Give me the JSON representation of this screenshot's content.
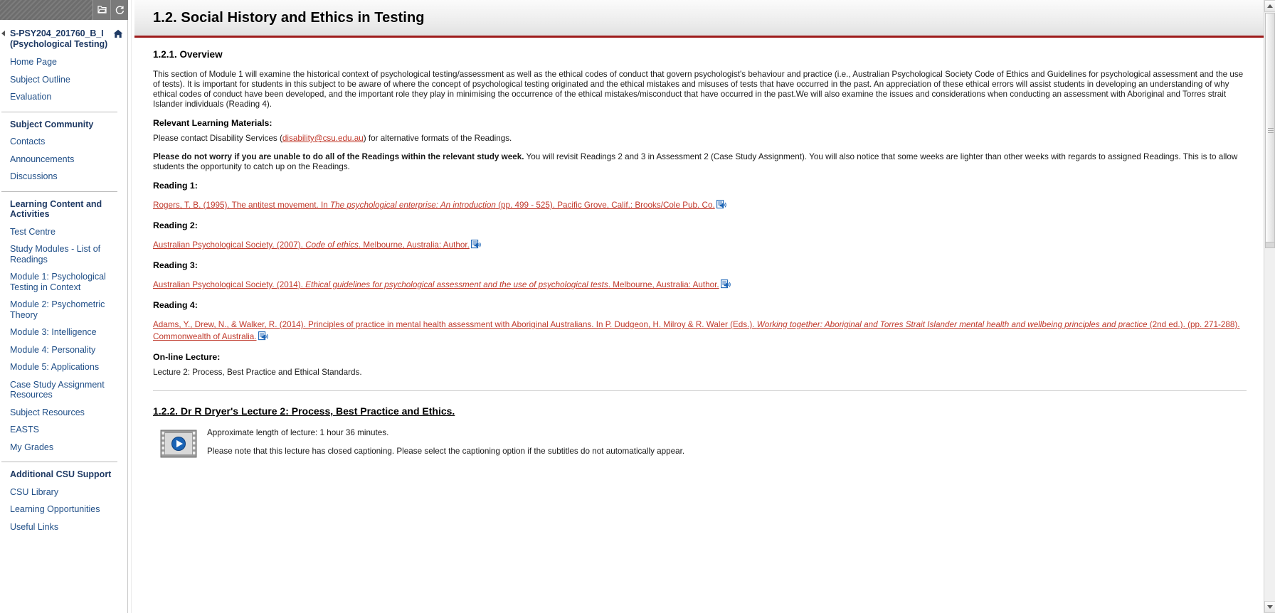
{
  "window": {
    "toolbar_buttons": [
      {
        "name": "folder-open-icon",
        "label": "Open folder"
      },
      {
        "name": "refresh-icon",
        "label": "Refresh"
      }
    ]
  },
  "sidebar": {
    "course_title": "S-PSY204_201760_B_I (Psychological Testing)",
    "home_icon_label": "Home",
    "groups": [
      {
        "heading": null,
        "items": [
          {
            "label": "Home Page"
          },
          {
            "label": "Subject Outline"
          },
          {
            "label": "Evaluation"
          }
        ]
      },
      {
        "heading": "Subject Community",
        "items": [
          {
            "label": "Contacts"
          },
          {
            "label": "Announcements"
          },
          {
            "label": "Discussions"
          }
        ]
      },
      {
        "heading": "Learning Content and Activities",
        "items": [
          {
            "label": "Test Centre"
          },
          {
            "label": "Study Modules - List of Readings"
          },
          {
            "label": "Module 1: Psychological Testing in Context"
          },
          {
            "label": "Module 2: Psychometric Theory"
          },
          {
            "label": "Module 3: Intelligence"
          },
          {
            "label": "Module 4: Personality"
          },
          {
            "label": "Module 5: Applications"
          },
          {
            "label": "Case Study Assignment Resources"
          },
          {
            "label": "Subject Resources"
          },
          {
            "label": "EASTS"
          },
          {
            "label": "My Grades"
          }
        ]
      },
      {
        "heading": "Additional CSU Support",
        "items": [
          {
            "label": "CSU Library"
          },
          {
            "label": "Learning Opportunities"
          },
          {
            "label": "Useful Links"
          }
        ]
      }
    ]
  },
  "header": {
    "title": "1.2. Social History and Ethics in Testing",
    "accent_color": "#9e1b1b"
  },
  "content": {
    "overview_heading": "1.2.1. Overview",
    "overview_paragraph": "This section of Module 1 will examine the historical context of psychological testing/assessment as well as the ethical codes of conduct that govern psychologist's behaviour and practice (i.e., Australian Psychological Society Code of Ethics and Guidelines for psychological assessment and the use of tests). It is important for students in this subject to be aware of where the concept of psychological testing originated and the ethical mistakes and misuses of tests that have occurred in the past. An appreciation of these ethical errors will assist students in developing an understanding of why ethical codes of conduct have been developed, and the important role they play in minimising the occurrence of the ethical mistakes/misconduct that have occurred in the past.We will also examine the issues and considerations when conducting an assessment with Aboriginal and Torres strait Islander individuals (Reading 4).",
    "materials_heading": "Relevant Learning Materials:",
    "disability_line_before": "Please contact Disability Services (",
    "disability_email": "disability@csu.edu.au",
    "disability_line_after": ") for alternative formats of the Readings.",
    "do_not_worry_bold": "Please do not worry if you are unable to do all of the Readings within the relevant study week.",
    "do_not_worry_rest": " You will revisit Readings 2 and 3 in Assessment 2 (Case Study Assignment). You will also notice that some weeks are lighter than other weeks with regards to assigned Readings. This is to allow students the opportunity to catch up on the Readings.",
    "readings": [
      {
        "label": "Reading 1:",
        "parts": [
          {
            "text": "Rogers, T. B. (1995). The antitest movement. In ",
            "italic": false
          },
          {
            "text": "The psychological enterprise: An introduction",
            "italic": true
          },
          {
            "text": " (pp. 499 - 525). Pacific Grove, Calif.: Brooks/Cole Pub. Co.",
            "italic": false
          }
        ],
        "icon": "audio-reading-icon"
      },
      {
        "label": "Reading 2:",
        "parts": [
          {
            "text": "Australian Psychological Society. (2007).  ",
            "italic": false
          },
          {
            "text": "Code of ethics",
            "italic": true
          },
          {
            "text": ". Melbourne, Australia: Author.",
            "italic": false
          }
        ],
        "icon": "audio-reading-icon"
      },
      {
        "label": "Reading 3:",
        "parts": [
          {
            "text": "Australian Psychological Society. (2014). ",
            "italic": false
          },
          {
            "text": "Ethical guidelines for psychological assessment and the use of psychological tests",
            "italic": true
          },
          {
            "text": ". Melbourne, Australia: Author.",
            "italic": false
          }
        ],
        "icon": "audio-reading-icon"
      },
      {
        "label": "Reading 4:",
        "parts": [
          {
            "text": "Adams, Y., Drew, N., & Walker, R. (2014). Principles of practice in mental health assessment with Aboriginal Australians. In P. Dudgeon, H. Milroy & R. Waler (Eds.). ",
            "italic": false
          },
          {
            "text": "Working together: Aboriginal and Torres Strait Islander mental health and wellbeing principles and practice",
            "italic": true
          },
          {
            "text": " (2nd ed.). (pp. 271-288). Commonwealth of Australia.",
            "italic": false
          }
        ],
        "icon": "audio-reading-icon"
      }
    ],
    "online_lecture_heading": "On-line Lecture:",
    "online_lecture_text": "Lecture 2: Process, Best Practice and Ethical Standards.",
    "lecture_section_title": "1.2.2. Dr R Dryer's Lecture 2: Process, Best Practice and Ethics.",
    "lecture_length_text": "Approximate length of lecture: 1 hour 36 minutes.",
    "lecture_caption_text": "Please note that this lecture has closed captioning. Please select the captioning option if the subtitles do not automatically appear.",
    "link_color": "#c0392b",
    "nav_link_color": "#1f4e87"
  }
}
